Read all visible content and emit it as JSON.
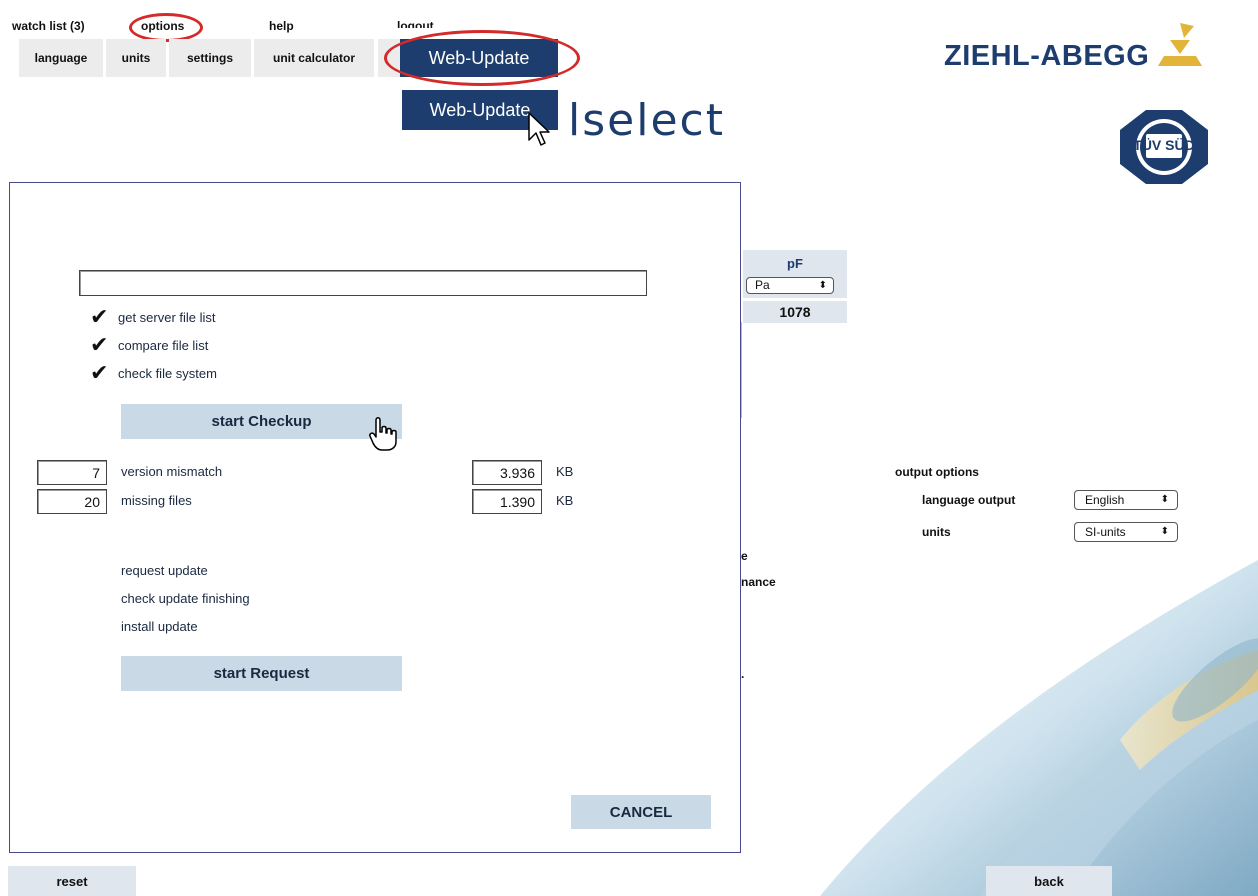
{
  "nav": {
    "menus": [
      "watch list (3)",
      "options",
      "help",
      "logout"
    ],
    "submenu": [
      "language",
      "units",
      "settings",
      "unit calculator"
    ],
    "web_update_label": "Web-Update",
    "web_update_tooltip": "Web-Update"
  },
  "app_title": "lselect",
  "brand": {
    "logo_text": "ZIEHL-ABEGG",
    "cert_badge": "TÜV SÜD"
  },
  "background_form": {
    "pf_label": "pF",
    "pf_unit": "Pa",
    "pf_value": "1078",
    "output_options_title": "output options",
    "language_output_label": "language output",
    "language_output_value": "English",
    "units_label": "units",
    "units_value": "SI-units",
    "stray_1": "e",
    "stray_2": "nance",
    "stray_3": "."
  },
  "modal": {
    "progress_text": "",
    "checklist": [
      "get server file list",
      "compare file list",
      "check file system"
    ],
    "start_checkup_label": "start Checkup",
    "stats": [
      {
        "count": "7",
        "label": "version mismatch",
        "size": "3.936",
        "unit": "KB"
      },
      {
        "count": "20",
        "label": "missing files",
        "size": "1.390",
        "unit": "KB"
      }
    ],
    "steps": [
      "request update",
      "check update finishing",
      "install update"
    ],
    "start_request_label": "start Request",
    "cancel_label": "CANCEL"
  },
  "footer": {
    "reset_label": "reset",
    "back_label": "back"
  },
  "colors": {
    "navy": "#1c3d6e",
    "highlight": "#d42a2a",
    "button_bg": "#c9dae6",
    "nav_bg": "#ececec"
  }
}
